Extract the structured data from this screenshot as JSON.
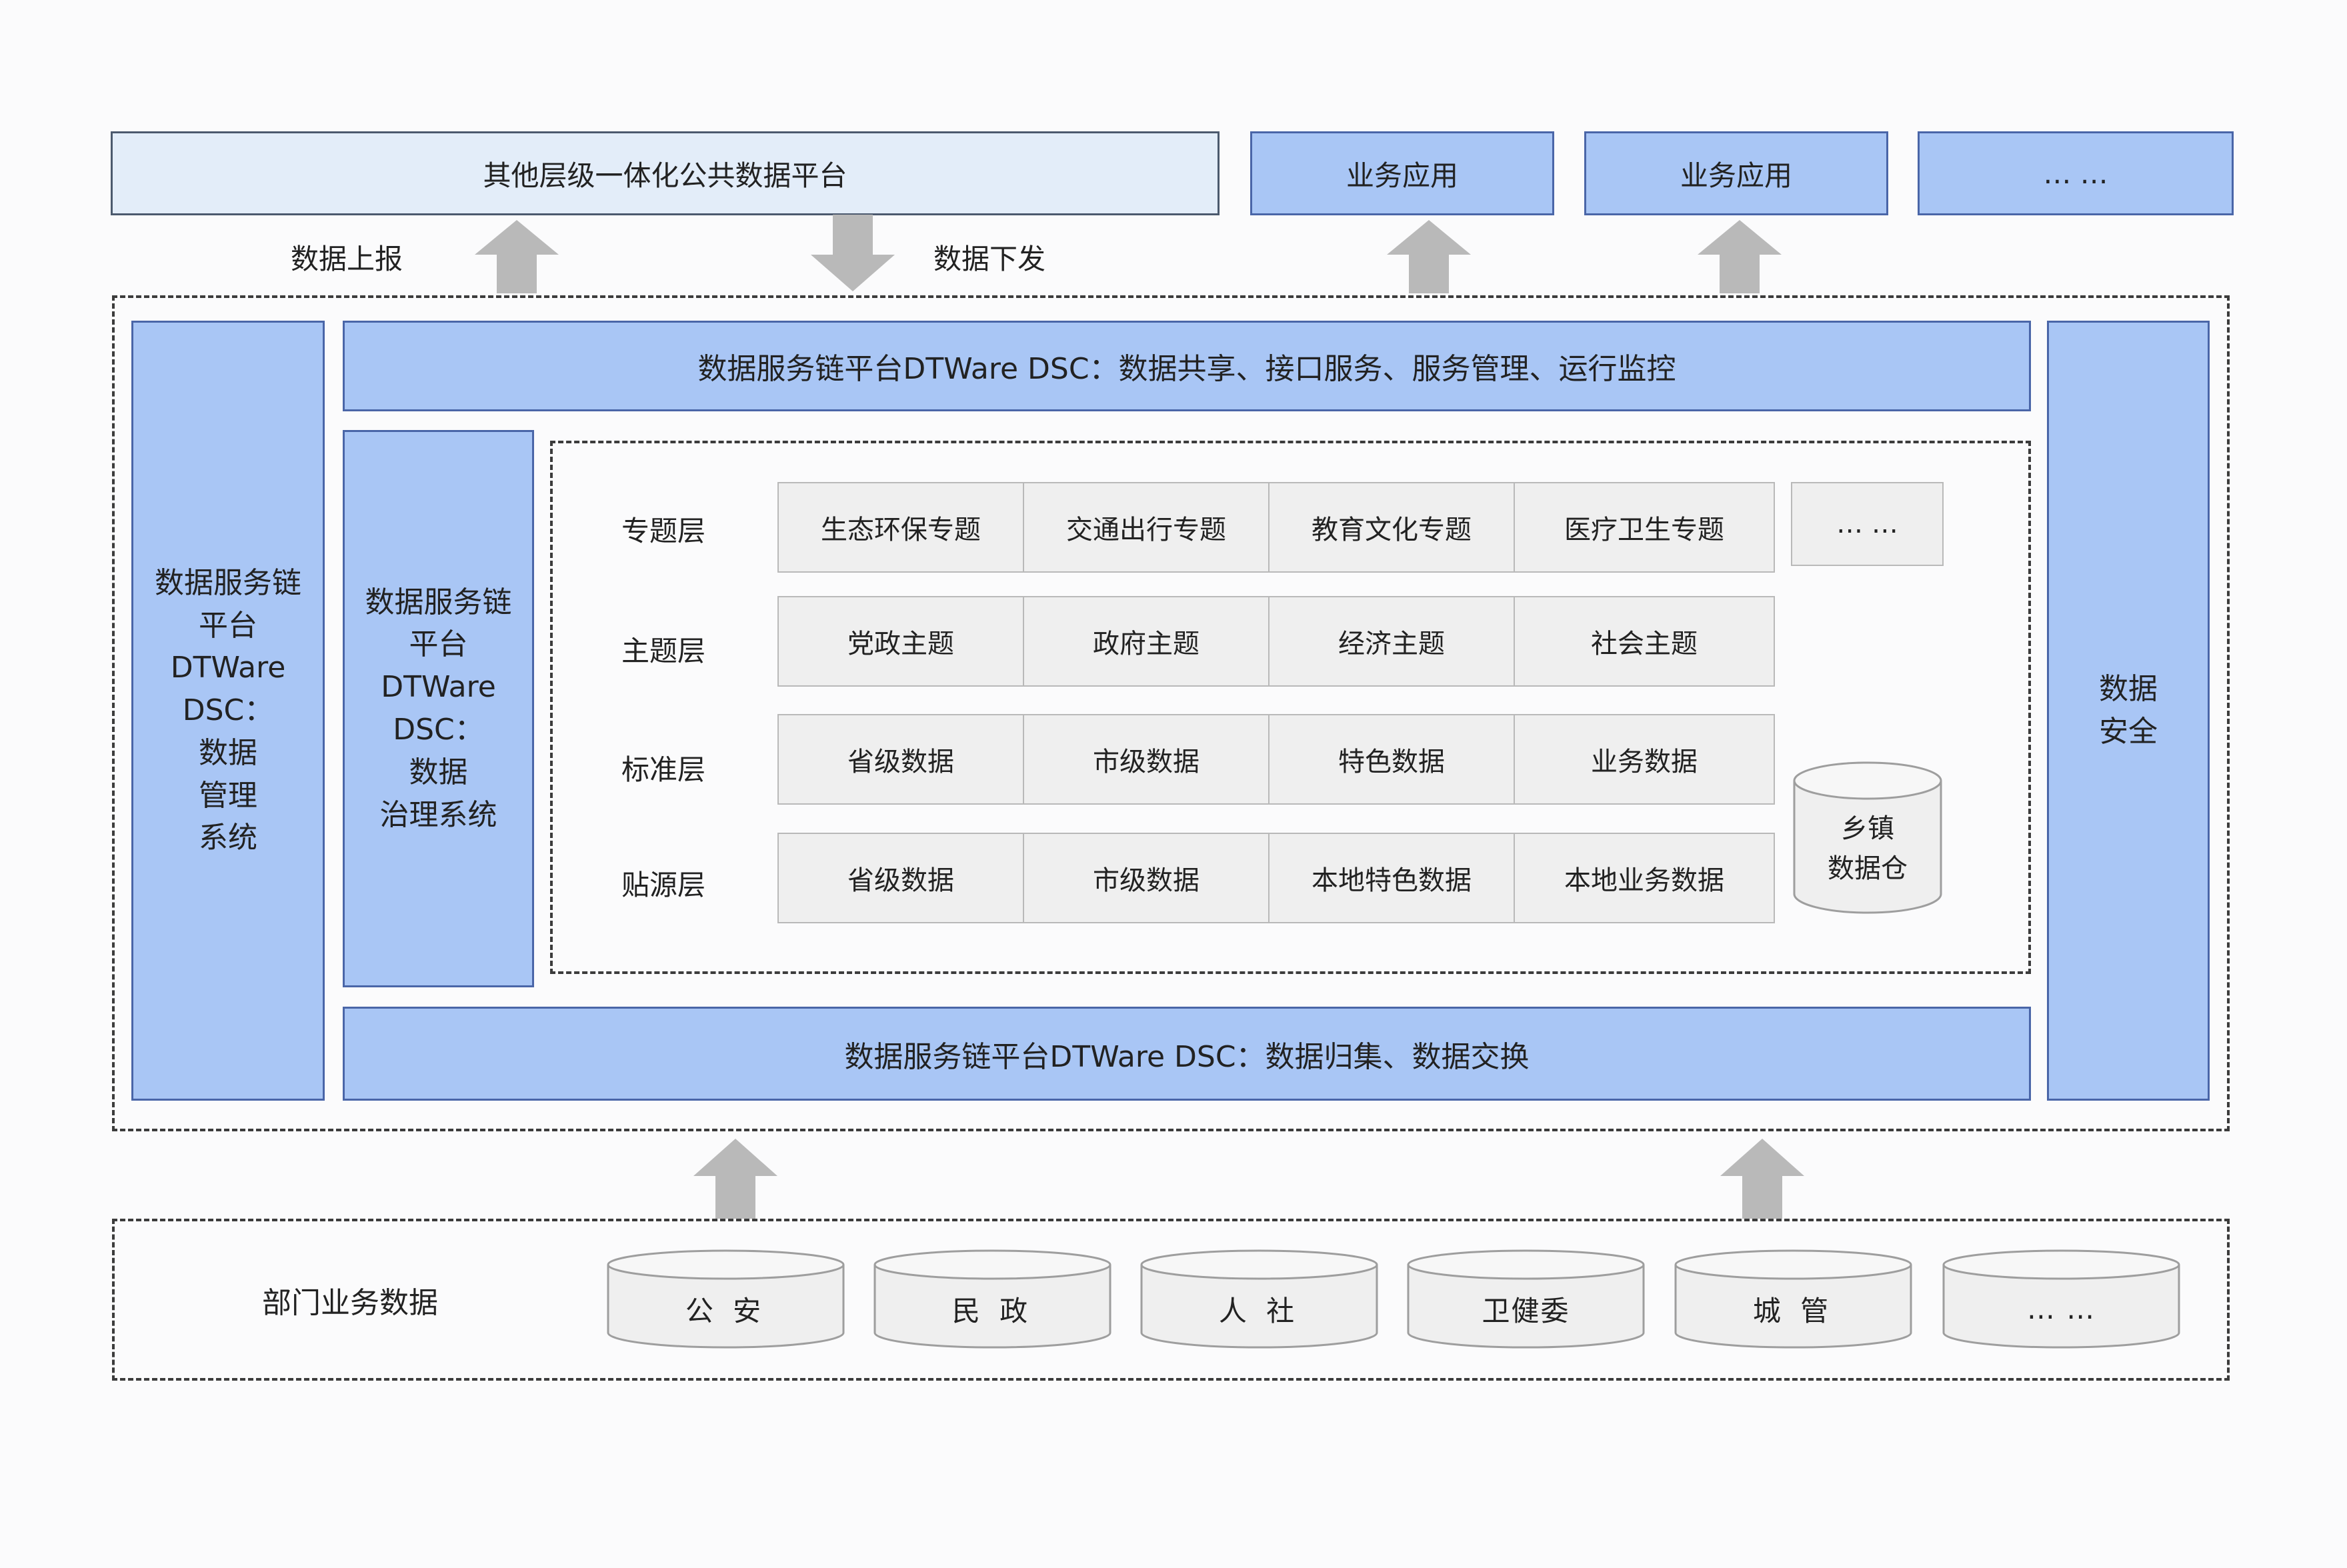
{
  "top": {
    "platform_label": "其他层级一体化公共数据平台",
    "apps": [
      "业务应用",
      "业务应用",
      "… …"
    ],
    "report_up": "数据上报",
    "issue_down": "数据下发"
  },
  "left_col": "数据服务链平台DTWare DSC：数据管理系统",
  "left_col_lines": [
    "数据服务链",
    "平台",
    "DTWare",
    "DSC：",
    "数据",
    "管理",
    "系统"
  ],
  "gov_col_lines": [
    "数据服务链",
    "平台",
    "DTWare",
    "DSC：",
    "数据",
    "治理系统"
  ],
  "right_col_lines": [
    "数据",
    "安全"
  ],
  "top_bar": "数据服务链平台DTWare DSC：数据共享、接口服务、服务管理、运行监控",
  "bottom_bar": "数据服务链平台DTWare DSC：数据归集、数据交换",
  "layers": [
    {
      "label": "专题层",
      "cells": [
        "生态环保专题",
        "交通出行专题",
        "教育文化专题",
        "医疗卫生专题"
      ]
    },
    {
      "label": "主题层",
      "cells": [
        "党政主题",
        "政府主题",
        "经济主题",
        "社会主题"
      ]
    },
    {
      "label": "标准层",
      "cells": [
        "省级数据",
        "市级数据",
        "特色数据",
        "业务数据"
      ]
    },
    {
      "label": "贴源层",
      "cells": [
        "省级数据",
        "市级数据",
        "本地特色数据",
        "本地业务数据"
      ]
    }
  ],
  "more_box": "… …",
  "warehouse_lines": [
    "乡镇",
    "数据仓"
  ],
  "dept": {
    "label": "部门业务数据",
    "sources": [
      "公 安",
      "民 政",
      "人 社",
      "卫健委",
      "城 管",
      "… …"
    ]
  }
}
